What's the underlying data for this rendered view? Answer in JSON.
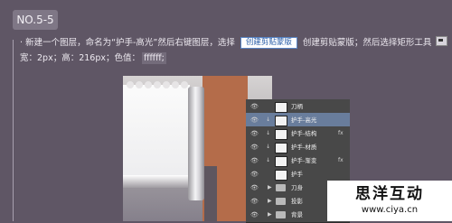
{
  "step": {
    "label": "NO.5-5"
  },
  "instruction": {
    "bullet": "·",
    "line1_a": "新建一个图层，命名为“护手-高光”然后右键图层，选择",
    "button_label": "创建剪贴蒙版",
    "line1_b": "创建剪贴蒙版；然后选择矩形工具",
    "tool_icon": "rectangle-tool-icon",
    "line2_a": "宽：2px；高：216px；色值：",
    "line2_value": "ffffff;"
  },
  "layers_panel": {
    "rows": [
      {
        "name": "刀柄",
        "kind": "layer",
        "selected": false,
        "clipped": false,
        "fx": ""
      },
      {
        "name": "护手-高光",
        "kind": "layer",
        "selected": true,
        "clipped": true,
        "fx": ""
      },
      {
        "name": "护手-结构",
        "kind": "layer",
        "selected": false,
        "clipped": true,
        "fx": "fx"
      },
      {
        "name": "护手-材质",
        "kind": "layer",
        "selected": false,
        "clipped": true,
        "fx": ""
      },
      {
        "name": "护手-渐变",
        "kind": "layer",
        "selected": false,
        "clipped": true,
        "fx": "fx"
      },
      {
        "name": "护手",
        "kind": "layer",
        "selected": false,
        "clipped": false,
        "fx": ""
      },
      {
        "name": "刀身",
        "kind": "group",
        "selected": false,
        "clipped": false,
        "fx": ""
      },
      {
        "name": "投影",
        "kind": "group",
        "selected": false,
        "clipped": false,
        "fx": ""
      },
      {
        "name": "背景",
        "kind": "group",
        "selected": false,
        "clipped": false,
        "fx": ""
      }
    ]
  },
  "watermark": {
    "name": "思洋互动",
    "url": "www.ciya.cn"
  },
  "colors": {
    "background": "#5f5665",
    "selected_layer": "#697d9c",
    "handle": "#b46c4a"
  }
}
